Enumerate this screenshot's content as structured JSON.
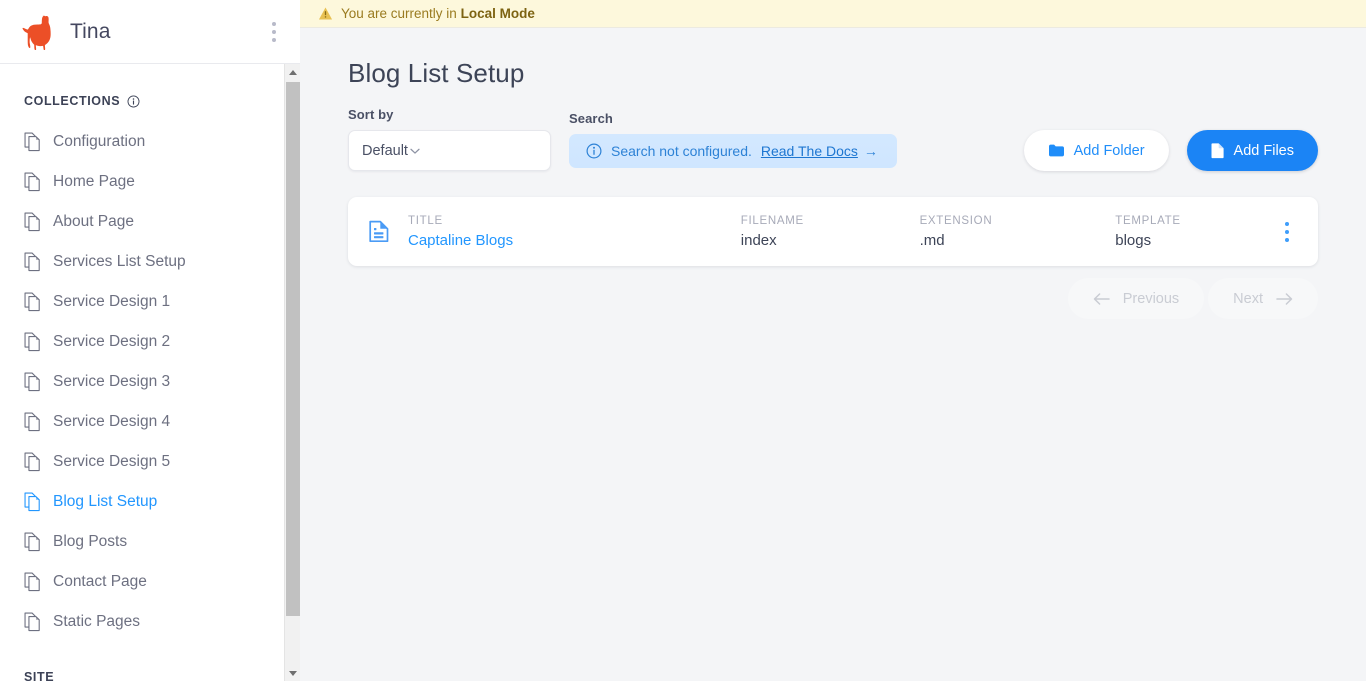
{
  "brand": {
    "name": "Tina",
    "logo_icon": "llama-logo",
    "menu_icon": "kebab-menu-icon"
  },
  "banner": {
    "icon": "warning-triangle-icon",
    "text_prefix": "You are currently in ",
    "mode": "Local Mode",
    "bg_color": "#fdf8dc",
    "text_color": "#9a7b20"
  },
  "sidebar": {
    "collections_label": "COLLECTIONS",
    "collections_info_icon": "info-circle-icon",
    "site_label": "SITE",
    "items": [
      {
        "label": "Configuration",
        "icon": "documents-icon",
        "active": false
      },
      {
        "label": "Home Page",
        "icon": "documents-icon",
        "active": false
      },
      {
        "label": "About Page",
        "icon": "documents-icon",
        "active": false
      },
      {
        "label": "Services List Setup",
        "icon": "documents-icon",
        "active": false
      },
      {
        "label": "Service Design 1",
        "icon": "documents-icon",
        "active": false
      },
      {
        "label": "Service Design 2",
        "icon": "documents-icon",
        "active": false
      },
      {
        "label": "Service Design 3",
        "icon": "documents-icon",
        "active": false
      },
      {
        "label": "Service Design 4",
        "icon": "documents-icon",
        "active": false
      },
      {
        "label": "Service Design 5",
        "icon": "documents-icon",
        "active": false
      },
      {
        "label": "Blog List Setup",
        "icon": "documents-icon",
        "active": true
      },
      {
        "label": "Blog Posts",
        "icon": "documents-icon",
        "active": false
      },
      {
        "label": "Contact Page",
        "icon": "documents-icon",
        "active": false
      },
      {
        "label": "Static Pages",
        "icon": "documents-icon",
        "active": false
      }
    ],
    "active_color": "#2296fe",
    "item_color": "#6d7081"
  },
  "main": {
    "page_title": "Blog List Setup",
    "sort": {
      "label": "Sort by",
      "selected": "Default",
      "chevron_icon": "chevron-down-icon"
    },
    "search": {
      "label": "Search",
      "icon": "info-circle-icon",
      "message": "Search not configured.",
      "docs_link": "Read The Docs",
      "arrow": "→"
    },
    "actions": {
      "add_folder": {
        "label": "Add Folder",
        "icon": "folder-icon"
      },
      "add_files": {
        "label": "Add Files",
        "icon": "file-icon"
      }
    },
    "table": {
      "columns": [
        "TITLE",
        "FILENAME",
        "EXTENSION",
        "TEMPLATE"
      ],
      "rows": [
        {
          "icon": "document-lines-icon",
          "title": "Captaline Blogs",
          "filename": "index",
          "extension": ".md",
          "template": "blogs",
          "menu_icon": "kebab-menu-icon"
        }
      ]
    },
    "pagination": {
      "previous": "Previous",
      "next": "Next",
      "prev_icon": "arrow-left-icon",
      "next_icon": "arrow-right-icon",
      "prev_disabled": true,
      "next_disabled": true
    }
  },
  "theme": {
    "accent": "#1b84f5",
    "link": "#2296fe",
    "page_bg": "#f4f5f7",
    "card_bg": "#ffffff"
  }
}
